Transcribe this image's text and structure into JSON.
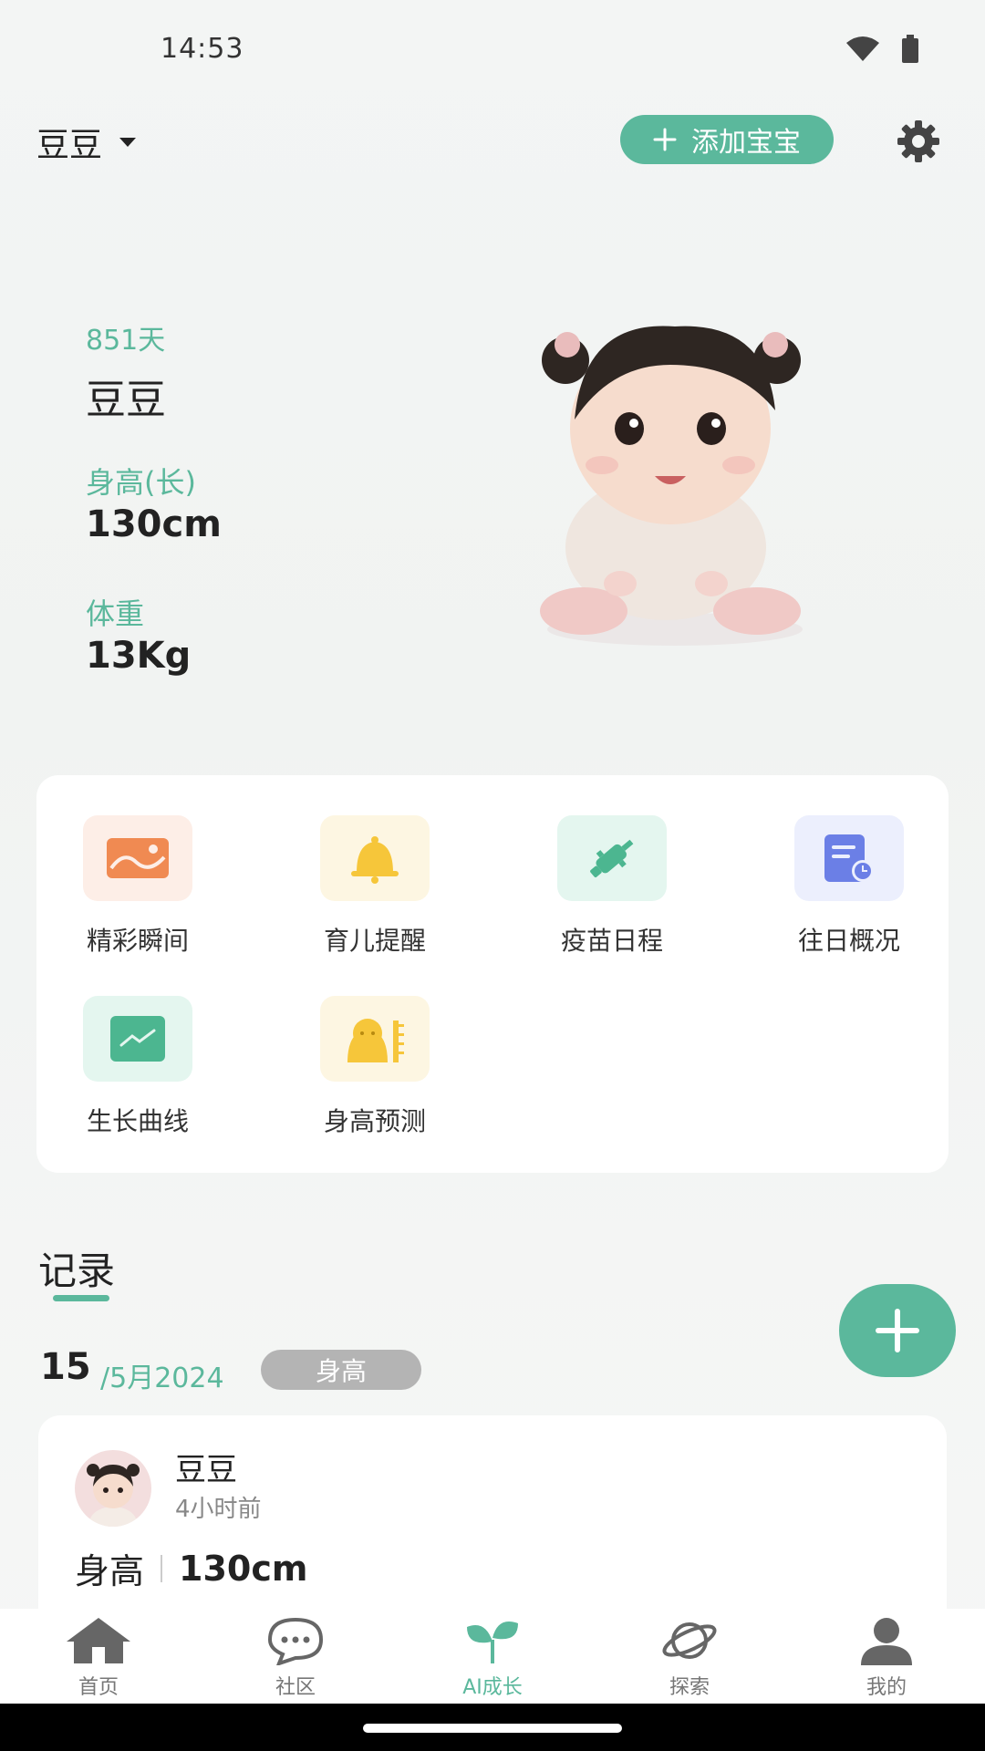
{
  "status_bar": {
    "time": "14:53"
  },
  "header": {
    "baby_name": "豆豆",
    "add_baby_label": "添加宝宝"
  },
  "hero": {
    "days": "851天",
    "name": "豆豆",
    "height_label": "身高(长)",
    "height_value": "130cm",
    "weight_label": "体重",
    "weight_value": "13Kg"
  },
  "features": [
    {
      "label": "精彩瞬间",
      "icon": "photo-icon"
    },
    {
      "label": "育儿提醒",
      "icon": "bell-icon"
    },
    {
      "label": "疫苗日程",
      "icon": "vaccine-icon"
    },
    {
      "label": "往日概况",
      "icon": "history-doc-icon"
    },
    {
      "label": "生长曲线",
      "icon": "growth-chart-icon"
    },
    {
      "label": "身高预测",
      "icon": "height-ruler-icon"
    }
  ],
  "records": {
    "title": "记录",
    "date_day": "15",
    "date_rest": "/5月2024",
    "tag": "身高",
    "card": {
      "name": "豆豆",
      "time": "4小时前",
      "metric_label": "身高",
      "metric_value": "130cm"
    }
  },
  "nav": [
    {
      "label": "首页",
      "icon": "home-icon"
    },
    {
      "label": "社区",
      "icon": "chat-icon"
    },
    {
      "label": "AI成长",
      "icon": "sprout-icon",
      "active": true
    },
    {
      "label": "探索",
      "icon": "planet-icon"
    },
    {
      "label": "我的",
      "icon": "person-icon"
    }
  ],
  "colors": {
    "accent": "#5bb89c"
  }
}
